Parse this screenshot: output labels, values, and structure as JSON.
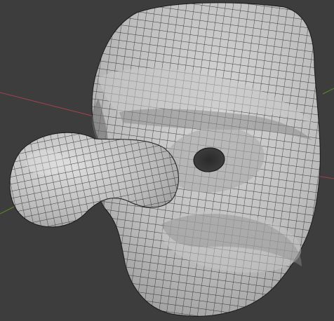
{
  "viewport": {
    "mode": "solid-shading-wireframe",
    "background_color": "#3d3d3d",
    "object": "mask-head-mesh",
    "mesh_color": "#b9b9b9",
    "wire_color": "#161616"
  },
  "axes": {
    "x_axis_color": "#a2424d",
    "y_axis_color": "#5a8b27"
  }
}
